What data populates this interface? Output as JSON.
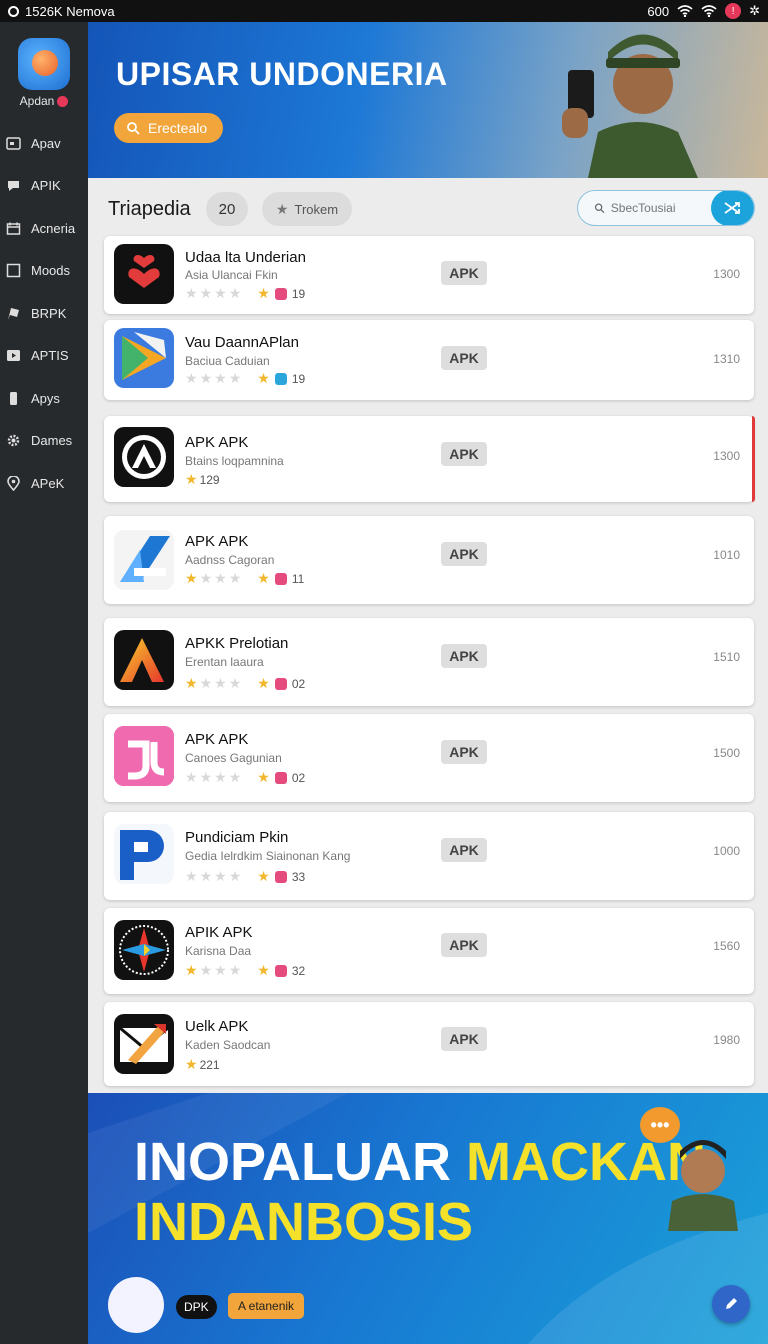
{
  "status": {
    "left_text": "1526K Nemova",
    "right_text": "600"
  },
  "sidebar": {
    "brand": "Apdan",
    "items": [
      {
        "label": "Apav",
        "icon": "tablet-icon"
      },
      {
        "label": "APIK",
        "icon": "chat-bubble-icon"
      },
      {
        "label": "Acneria",
        "icon": "calendar-icon"
      },
      {
        "label": "Moods",
        "icon": "square-icon"
      },
      {
        "label": "BRPK",
        "icon": "flag-icon"
      },
      {
        "label": "APTIS",
        "icon": "play-icon"
      },
      {
        "label": "Apys",
        "icon": "phone-icon"
      },
      {
        "label": "Dames",
        "icon": "gear-icon"
      },
      {
        "label": "APeK",
        "icon": "location-icon"
      }
    ]
  },
  "hero": {
    "title": "UPISAR UNDONERIA",
    "button": "Erectealo"
  },
  "filters": {
    "heading": "Triapedia",
    "count": "20",
    "chip": "Trokem",
    "search_placeholder": "SbecTousiai"
  },
  "apps": [
    {
      "name": "Udaa lta Underian",
      "subtitle": "Asia Ulancai Fkin",
      "rating_count": "19",
      "stars_filled": 0,
      "badge": "APK",
      "size": "1300"
    },
    {
      "name": "Vau DaannAPlan",
      "subtitle": "Baciua Caduian",
      "rating_count": "19",
      "stars_filled": 0,
      "badge": "APK",
      "size": "1310"
    },
    {
      "name": "APK APK",
      "subtitle": "Btains loqpamnina",
      "rating_count": "129",
      "stars_filled": 1,
      "badge": "APK",
      "size": "1300"
    },
    {
      "name": "APK APK",
      "subtitle": "Aadnss Cagoran",
      "rating_count": "11",
      "stars_filled": 1,
      "badge": "APK",
      "size": "1010"
    },
    {
      "name": "APKK Prelotian",
      "subtitle": "Erentan laaura",
      "rating_count": "02",
      "stars_filled": 1,
      "badge": "APK",
      "size": "1510"
    },
    {
      "name": "APK APK",
      "subtitle": "Canoes Gagunian",
      "rating_count": "02",
      "stars_filled": 0,
      "badge": "APK",
      "size": "1500"
    },
    {
      "name": "Pundiciam Pkin",
      "subtitle": "Gedia Ielrdkim Siainonan Kang",
      "rating_count": "33",
      "stars_filled": 0,
      "badge": "APK",
      "size": "1000"
    },
    {
      "name": "APIK APK",
      "subtitle": "Karisna Daa",
      "rating_count": "32",
      "stars_filled": 1,
      "badge": "APK",
      "size": "1560"
    },
    {
      "name": "Uelk APK",
      "subtitle": "Kaden Saodcan",
      "rating_count": "221",
      "stars_filled": 1,
      "badge": "APK",
      "size": "1980"
    }
  ],
  "banner": {
    "line1a": "INOPALUAR",
    "line1b": "MACKAN",
    "line2": "INDANBOSIS",
    "tag1": "DPK",
    "tag2": "A etanenik"
  },
  "colors": {
    "sidebar": "#262a2d",
    "accent_orange": "#f1a53a",
    "accent_blue": "#1da3dc",
    "star": "#f2b72c"
  }
}
